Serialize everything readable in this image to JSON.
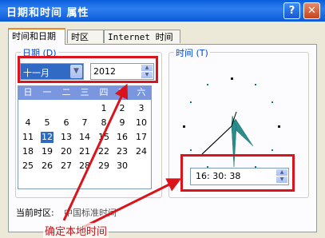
{
  "window": {
    "title": "日期和时间 属性",
    "help_glyph": "?",
    "close_glyph": "✕"
  },
  "tabs": [
    {
      "label": "时间和日期"
    },
    {
      "label": "时区"
    },
    {
      "label": "Internet 时间"
    }
  ],
  "date_group": {
    "label": "日期 (D)",
    "month_value": "十一月",
    "year_value": "2012"
  },
  "calendar": {
    "weekdays": [
      "日",
      "一",
      "二",
      "三",
      "四",
      "五",
      "六"
    ],
    "rows": [
      [
        "",
        "",
        "",
        "",
        "1",
        "2",
        "3"
      ],
      [
        "4",
        "5",
        "6",
        "7",
        "8",
        "9",
        "10"
      ],
      [
        "11",
        "12",
        "13",
        "14",
        "15",
        "16",
        "17"
      ],
      [
        "18",
        "19",
        "20",
        "21",
        "22",
        "23",
        "24"
      ],
      [
        "25",
        "26",
        "27",
        "28",
        "29",
        "30",
        ""
      ]
    ],
    "selected": "12"
  },
  "time_group": {
    "label": "时间 (T)",
    "time_value": "16: 30: 38"
  },
  "timezone": {
    "label": "当前时区:",
    "value": "中国标准时间"
  },
  "annotation": {
    "text": "确定本地时间",
    "color": "#d9141c"
  },
  "colors": {
    "title_bar": "#0a5fdc",
    "dialog_bg": "#ece9d8",
    "calendar_header": "#7a96df",
    "selected_day": "#316ac5"
  }
}
